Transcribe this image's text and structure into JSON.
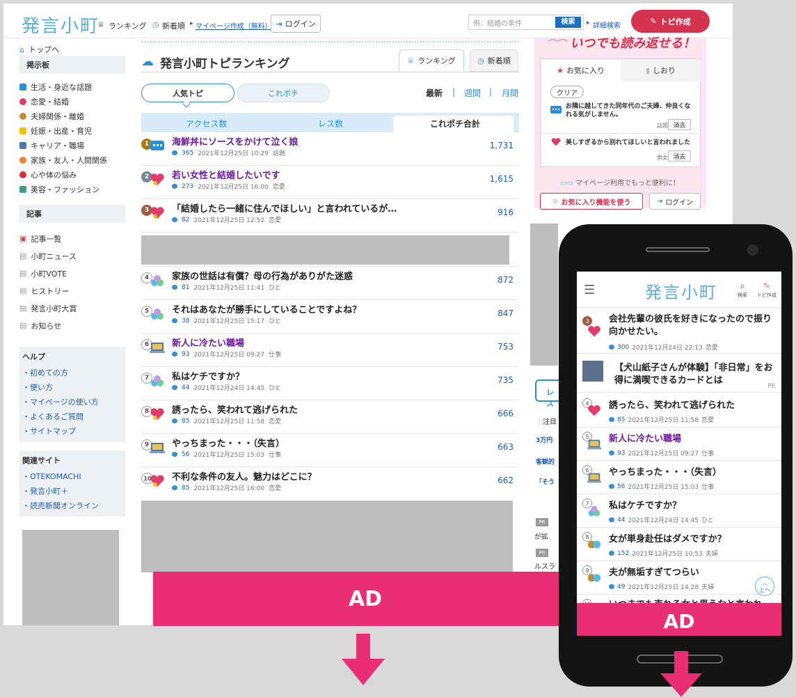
{
  "header": {
    "logo": "発言小町",
    "nav_ranking": "ランキング",
    "nav_new": "新着順",
    "mypage_link": "マイページ作成（無料）",
    "login": "ログイン",
    "search_placeholder": "例：結婚の条件",
    "search_btn": "検索",
    "detail_search": "詳細検索",
    "create_topic": "トピ作成"
  },
  "sidebar": {
    "top_link": "トップへ",
    "board_head": "掲示板",
    "board_items": [
      {
        "label": "生活・身近な話題",
        "color": "#2b8fd6"
      },
      {
        "label": "恋愛・結婚",
        "color": "#e23d6a"
      },
      {
        "label": "夫婦関係・離婚",
        "color": "#c28b2c"
      },
      {
        "label": "妊娠・出産・育児",
        "color": "#f2c200"
      },
      {
        "label": "キャリア・職場",
        "color": "#4d7aa6"
      },
      {
        "label": "家族・友人・人間関係",
        "color": "#e6852d"
      },
      {
        "label": "心や体の悩み",
        "color": "#d93232"
      },
      {
        "label": "美容・ファッション",
        "color": "#3aa18a"
      }
    ],
    "article_head": "記事",
    "article_items": [
      "記事一覧",
      "小町ニュース",
      "小町VOTE",
      "ヒストリー",
      "発言小町大賞",
      "お知らせ"
    ],
    "help_head": "ヘルプ",
    "help_items": [
      "・初めての方",
      "・使い方",
      "・マイページの使い方",
      "・よくあるご質問",
      "・サイトマップ"
    ],
    "related_head": "関連サイト",
    "related_items": [
      "・OTEKOMACHI",
      "・発言小町＋",
      "・読売新聞オンライン"
    ]
  },
  "main": {
    "title": "発言小町トピランキング",
    "tab_ranking": "ランキング",
    "tab_new": "新着順",
    "pill_popular": "人気トピ",
    "pill_korepochi": "これポチ",
    "period_latest": "最新",
    "period_week": "週間",
    "period_month": "月間",
    "sep": "|",
    "col_access": "アクセス数",
    "col_res": "レス数",
    "col_korepochi": "これポチ合計",
    "rows": [
      {
        "rank": "1",
        "title": "海鮮丼にソースをかけて泣く娘",
        "res": "365",
        "date": "2021年12月25日 10:29",
        "cat": "話題",
        "value": "1,731"
      },
      {
        "rank": "2",
        "title": "若い女性と結婚したいです",
        "res": "273",
        "date": "2021年12月25日 16:00",
        "cat": "恋愛",
        "value": "1,615"
      },
      {
        "rank": "3",
        "title": "「結婚したら一緒に住んでほしい」と言われているが…",
        "res": "82",
        "date": "2021年12月25日 12:52",
        "cat": "恋愛",
        "value": "916"
      },
      {
        "rank": "4",
        "title": "家族の世話は有償？母の行為がありがた迷惑",
        "res": "81",
        "date": "2021年12月25日 11:41",
        "cat": "ひと",
        "value": "872"
      },
      {
        "rank": "5",
        "title": "それはあなたが勝手にしていることですよね？",
        "res": "38",
        "date": "2021年12月25日 15:17",
        "cat": "ひと",
        "value": "847"
      },
      {
        "rank": "6",
        "title": "新人に冷たい職場",
        "res": "93",
        "date": "2021年12月25日 09:27",
        "cat": "仕事",
        "value": "753"
      },
      {
        "rank": "7",
        "title": "私はケチですか？",
        "res": "44",
        "date": "2021年12月24日 14:45",
        "cat": "ひと",
        "value": "735"
      },
      {
        "rank": "8",
        "title": "誘ったら、笑われて逃げられた",
        "res": "85",
        "date": "2021年12月25日 11:58",
        "cat": "恋愛",
        "value": "666"
      },
      {
        "rank": "9",
        "title": "やっちまった・・・（失言）",
        "res": "56",
        "date": "2021年12月25日 15:03",
        "cat": "仕事",
        "value": "663"
      },
      {
        "rank": "10",
        "title": "不利な条件の友人。魅力はどこに？",
        "res": "85",
        "date": "2021年12月25日 16:00",
        "cat": "恋愛",
        "value": "662"
      }
    ]
  },
  "right": {
    "banner": "いつでも読み返せる！",
    "tab_fav": "お気に入り",
    "tab_bookmark": "しおり",
    "clear": "クリア",
    "fav1": "お隣に越してきた同年代のご夫婦、仲良くなれる気がしません。",
    "fav1_cat": "話題",
    "fav2": "美しすぎるから別れてほしいと言われました",
    "fav2_cat": "男女",
    "delete": "消去",
    "mypage_note": "マイページ利用でもっと便利に！",
    "fav_btn": "お気に入り機能を使う",
    "login": "ログイン",
    "peek": [
      "レス",
      "注目",
      "3万円",
      "客観的",
      "「そう",
      "PR",
      "が拡",
      "PR",
      "ルスラ"
    ]
  },
  "ad_label": "AD",
  "phone": {
    "logo": "発言小町",
    "search": "検索",
    "create": "トピ作成",
    "top_btn": "上へ",
    "rows": [
      {
        "rank": "3",
        "title": "会社先輩の彼氏を好きになったので振り向かせたい。",
        "res": "300",
        "date": "2021年12月24日 22:13",
        "cat": "恋愛"
      },
      {
        "rank": "",
        "title": "【犬山紙子さんが体験】「非日常」をお得に満喫できるカードとは",
        "pr": "PR"
      },
      {
        "rank": "4",
        "title": "誘ったら、笑われて逃げられた",
        "res": "85",
        "date": "2021年12月25日 11:58",
        "cat": "恋愛"
      },
      {
        "rank": "5",
        "title": "新人に冷たい職場",
        "res": "93",
        "date": "2021年12月25日 09:27",
        "cat": "仕事"
      },
      {
        "rank": "6",
        "title": "やっちまった・・・（失言）",
        "res": "56",
        "date": "2021年12月25日 15:03",
        "cat": "仕事"
      },
      {
        "rank": "7",
        "title": "私はケチですか？",
        "res": "44",
        "date": "2021年12月24日 14:45",
        "cat": "ひと"
      },
      {
        "rank": "8",
        "title": "女が単身赴任はダメですか？",
        "res": "152",
        "date": "2021年12月25日 10:53",
        "cat": "夫婦"
      },
      {
        "rank": "9",
        "title": "夫が無垢すぎてつらい",
        "res": "49",
        "date": "2021年12月25日 14:28",
        "cat": "夫婦"
      },
      {
        "rank": "10",
        "title": "いつまでも売れる女と思うなと言われ"
      }
    ]
  }
}
